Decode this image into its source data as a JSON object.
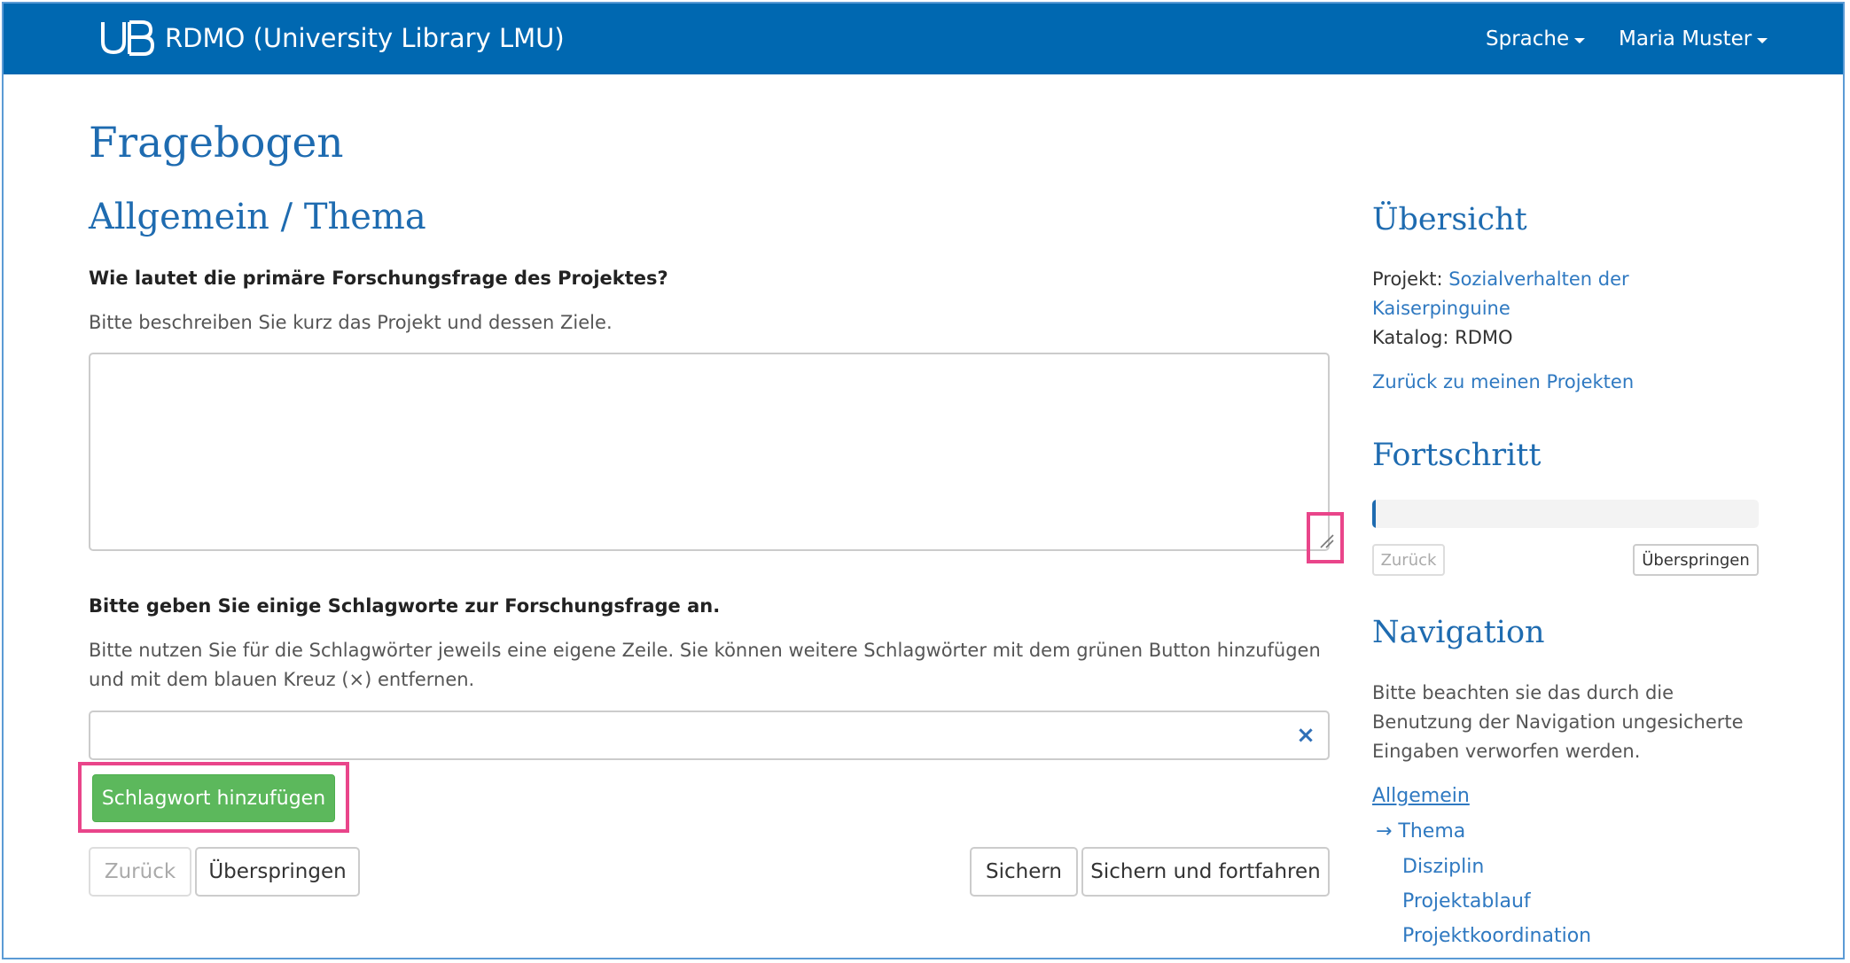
{
  "navbar": {
    "brand_title": "RDMO (University Library LMU)",
    "language_menu": "Sprache",
    "user_menu": "Maria Muster",
    "background_color": "#0068b1"
  },
  "main": {
    "page_title": "Fragebogen",
    "section_title": "Allgemein / Thema",
    "question1": {
      "label": "Wie lautet die primäre Forschungsfrage des Projektes?",
      "help": "Bitte beschreiben Sie kurz das Projekt und dessen Ziele.",
      "value": ""
    },
    "question2": {
      "label": "Bitte geben Sie einige Schlagworte zur Forschungsfrage an.",
      "help_line1": "Bitte nutzen Sie für die Schlagwörter jeweils eine eigene Zeile. Sie können weitere Schlagwörter mit dem grünen Button hinzufügen",
      "help_line2": "und mit dem blauen Kreuz (×) entfernen.",
      "value": "",
      "remove_icon": "×",
      "add_button": "Schlagwort hinzufügen"
    },
    "buttons": {
      "back": "Zurück",
      "skip": "Überspringen",
      "save": "Sichern",
      "save_continue": "Sichern und fortfahren"
    }
  },
  "sidebar": {
    "overview_title": "Übersicht",
    "project_label": "Projekt:",
    "project_name_line1": "Sozialverhalten der",
    "project_name_line2": "Kaiserpinguine",
    "catalog": "Katalog: RDMO",
    "back_to_projects": "Zurück zu meinen Projekten",
    "progress_title": "Fortschritt",
    "progress_fraction": 0.01,
    "progress_back": "Zurück",
    "progress_skip": "Überspringen",
    "navigation_title": "Navigation",
    "navigation_note_line1": "Bitte beachten sie das durch die",
    "navigation_note_line2": "Benutzung der Navigation ungesicherte",
    "navigation_note_line3": "Eingaben verworfen werden.",
    "nav_items": {
      "section": "Allgemein",
      "current": "→ Thema",
      "item2": "Disziplin",
      "item3": "Projektablauf",
      "item4": "Projektkoordination"
    }
  },
  "colors": {
    "accent": "#1e6bb0",
    "success": "#5cb85c",
    "highlight": "#e9458a"
  }
}
